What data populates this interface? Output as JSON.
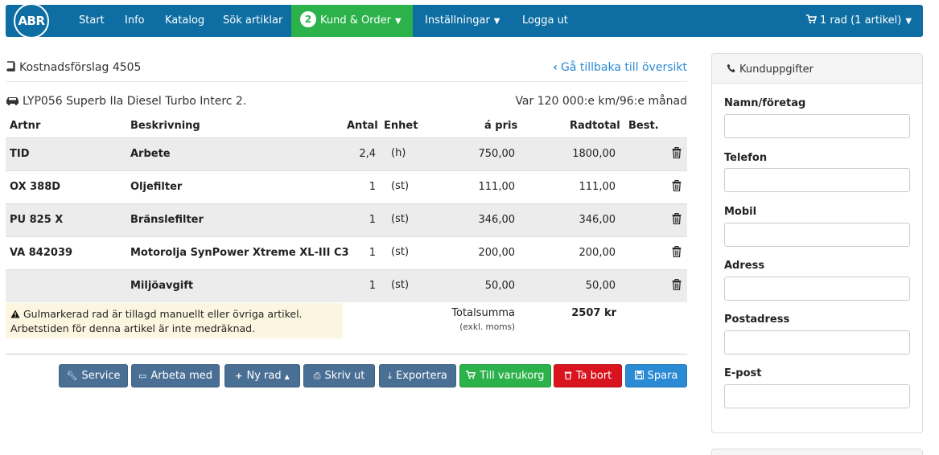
{
  "brand": {
    "logo_text": "ABR"
  },
  "nav": {
    "start": "Start",
    "info": "Info",
    "katalog": "Katalog",
    "sok": "Sök artiklar",
    "kund_order": "Kund & Order",
    "kund_order_badge": "2",
    "installningar": "Inställningar",
    "logga_ut": "Logga ut",
    "cart": "1 rad (1 artikel)"
  },
  "header": {
    "title": "Kostnadsförslag 4505",
    "back_link": "Gå tillbaka till översikt",
    "vehicle": "LYP056 Superb IIa Diesel Turbo Interc 2.",
    "service_interval": "Var 120 000:e km/96:e månad"
  },
  "table": {
    "columns": [
      "Artnr",
      "Beskrivning",
      "Antal",
      "Enhet",
      "á pris",
      "Radtotal",
      "Best."
    ],
    "rows": [
      {
        "artnr": "TID",
        "beskrivning": "Arbete",
        "antal": "2,4",
        "enhet": "(h)",
        "pris": "750,00",
        "radtotal": "1800,00"
      },
      {
        "artnr": "OX 388D",
        "beskrivning": "Oljefilter",
        "antal": "1",
        "enhet": "(st)",
        "pris": "111,00",
        "radtotal": "111,00"
      },
      {
        "artnr": "PU 825 X",
        "beskrivning": "Bränslefilter",
        "antal": "1",
        "enhet": "(st)",
        "pris": "346,00",
        "radtotal": "346,00"
      },
      {
        "artnr": "VA 842039",
        "beskrivning": "Motorolja SynPower Xtreme XL-III C3",
        "antal": "1",
        "enhet": "(st)",
        "pris": "200,00",
        "radtotal": "200,00"
      },
      {
        "artnr": "",
        "beskrivning": "Miljöavgift",
        "antal": "1",
        "enhet": "(st)",
        "pris": "50,00",
        "radtotal": "50,00"
      }
    ]
  },
  "notice": {
    "line1": "Gulmarkerad rad är tillagd manuellt eller övriga artikel.",
    "line2": "Arbetstiden för denna artikel är inte medräknad."
  },
  "totals": {
    "label": "Totalsumma",
    "sublabel": "(exkl. moms)",
    "value": "2507 kr"
  },
  "buttons": {
    "service": "Service",
    "arbeta_med": "Arbeta med",
    "ny_rad": "Ny rad",
    "skriv_ut": "Skriv ut",
    "exportera": "Exportera",
    "till_varukorg": "Till varukorg",
    "ta_bort": "Ta bort",
    "spara": "Spara"
  },
  "sidebar": {
    "title": "Kunduppgifter",
    "fields": {
      "namn": {
        "label": "Namn/företag",
        "value": ""
      },
      "telefon": {
        "label": "Telefon",
        "value": ""
      },
      "mobil": {
        "label": "Mobil",
        "value": ""
      },
      "adress": {
        "label": "Adress",
        "value": ""
      },
      "postadress": {
        "label": "Postadress",
        "value": ""
      },
      "epost": {
        "label": "E-post",
        "value": ""
      }
    }
  },
  "colors": {
    "nav_bg": "#0e6ea3",
    "nav_active": "#2bb24a",
    "link": "#2a8ad4",
    "btn_blue": "#4a6f95",
    "btn_green": "#2bb24a",
    "btn_red": "#d9141f",
    "btn_sky": "#2a8ad4",
    "notice_bg": "#fcf6e0",
    "row_alt": "#ececec"
  }
}
